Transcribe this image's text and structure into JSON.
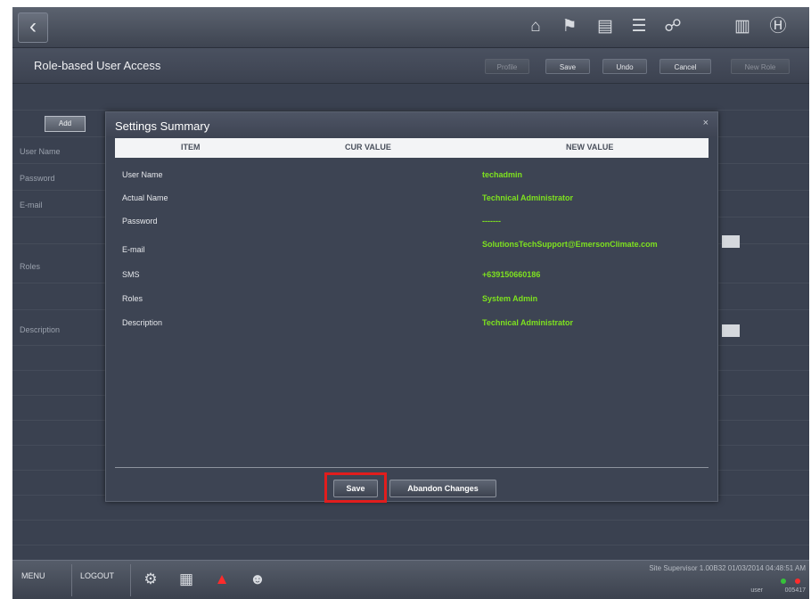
{
  "topbar": {
    "back_icon": "chevron-left-icon",
    "icons": [
      "home-icon",
      "flag-icon",
      "panel-icon",
      "list-icon",
      "network-icon",
      "book-icon",
      "help-icon"
    ]
  },
  "header": {
    "title": "Role-based User Access",
    "buttons": {
      "profile": "Profile",
      "save": "Save",
      "undo": "Undo",
      "cancel": "Cancel",
      "new_role": "New Role"
    }
  },
  "background_form": {
    "add_label": "Add",
    "labels": {
      "user_name": "User Name",
      "password": "Password",
      "email": "E-mail",
      "roles": "Roles",
      "description": "Description"
    }
  },
  "modal": {
    "title": "Settings Summary",
    "close": "×",
    "columns": {
      "item": "ITEM",
      "cur_value": "CUR VALUE",
      "new_value": "NEW VALUE"
    },
    "rows": [
      {
        "item": "User Name",
        "cur_value": "",
        "new_value": "techadmin"
      },
      {
        "item": "Actual Name",
        "cur_value": "",
        "new_value": "Technical Administrator"
      },
      {
        "item": "Password",
        "cur_value": "",
        "new_value": "-------"
      },
      {
        "item": "E-mail",
        "cur_value": "",
        "new_value": "SolutionsTechSupport@EmersonClimate.com"
      },
      {
        "item": "SMS",
        "cur_value": "",
        "new_value": "+639150660186"
      },
      {
        "item": "Roles",
        "cur_value": "",
        "new_value": "System Admin"
      },
      {
        "item": "Description",
        "cur_value": "",
        "new_value": "Technical Administrator"
      }
    ],
    "buttons": {
      "save": "Save",
      "abandon": "Abandon Changes"
    },
    "highlight_color": "#e11d1d"
  },
  "bottombar": {
    "menu": "MENU",
    "logout": "LOGOUT",
    "icons": [
      "settings-icon",
      "calendar-icon",
      "alarm-bell-icon",
      "users-icon"
    ],
    "status": "Site Supervisor 1.00B32 01/03/2014 04:48:51 AM",
    "user": "user",
    "count": "005417"
  },
  "colors": {
    "accent_green": "#7ee21f",
    "alarm_red": "#ff2b2b"
  }
}
